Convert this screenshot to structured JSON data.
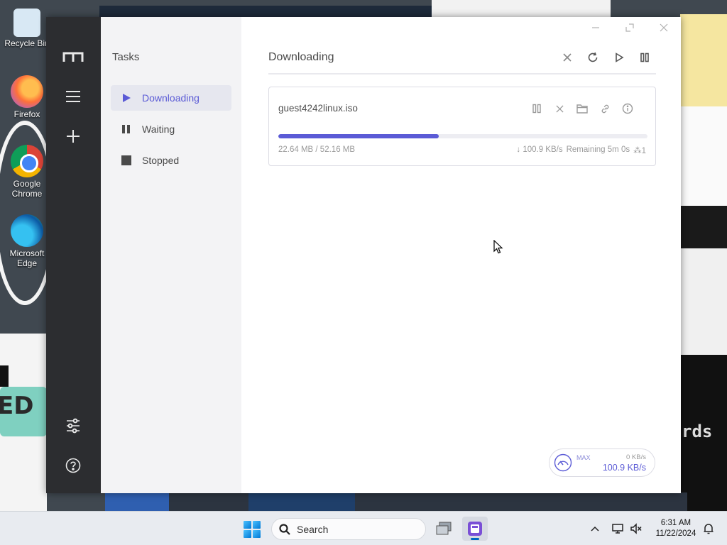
{
  "desktop": {
    "icons": [
      {
        "label": "Recycle Bin"
      },
      {
        "label": "Firefox"
      },
      {
        "label": "Google Chrome"
      },
      {
        "label": "Microsoft Edge"
      }
    ],
    "wallpaper_text": [
      "ED",
      "rds"
    ]
  },
  "app": {
    "rail": {
      "logo_icon": "m-logo-icon",
      "menu_icon": "menu-icon",
      "add_icon": "plus-icon",
      "settings_icon": "sliders-icon",
      "help_icon": "help-icon"
    },
    "sidebar": {
      "title": "Tasks",
      "items": [
        {
          "label": "Downloading",
          "icon": "play-icon",
          "active": true
        },
        {
          "label": "Waiting",
          "icon": "pause-icon",
          "active": false
        },
        {
          "label": "Stopped",
          "icon": "stop-icon",
          "active": false
        }
      ]
    },
    "main": {
      "title": "Downloading",
      "toolbar_icons": [
        "close-icon",
        "refresh-icon",
        "play-icon",
        "pause-icon"
      ],
      "tasks": [
        {
          "name": "guest4242linux.iso",
          "progress": 0.434,
          "downloaded": "22.64 MB",
          "total": "52.16 MB",
          "size_text": "22.64 MB / 52.16 MB",
          "speed_text": "↓ 100.9 KB/s",
          "remaining_text": "Remaining 5m 0s",
          "connections_text": "⁂1",
          "actions": [
            "pause-icon",
            "close-icon",
            "folder-icon",
            "link-icon",
            "info-icon"
          ]
        }
      ]
    },
    "speedometer": {
      "mode": "MAX",
      "upload": "0 KB/s",
      "download": "100.9 KB/s"
    }
  },
  "taskbar": {
    "search_placeholder": "Search",
    "time": "6:31 AM",
    "date": "11/22/2024"
  },
  "colors": {
    "accent": "#5b5bd6",
    "rail": "#2c2d30",
    "sidebar": "#f3f3f5",
    "active_item": "#e6e7ef"
  }
}
